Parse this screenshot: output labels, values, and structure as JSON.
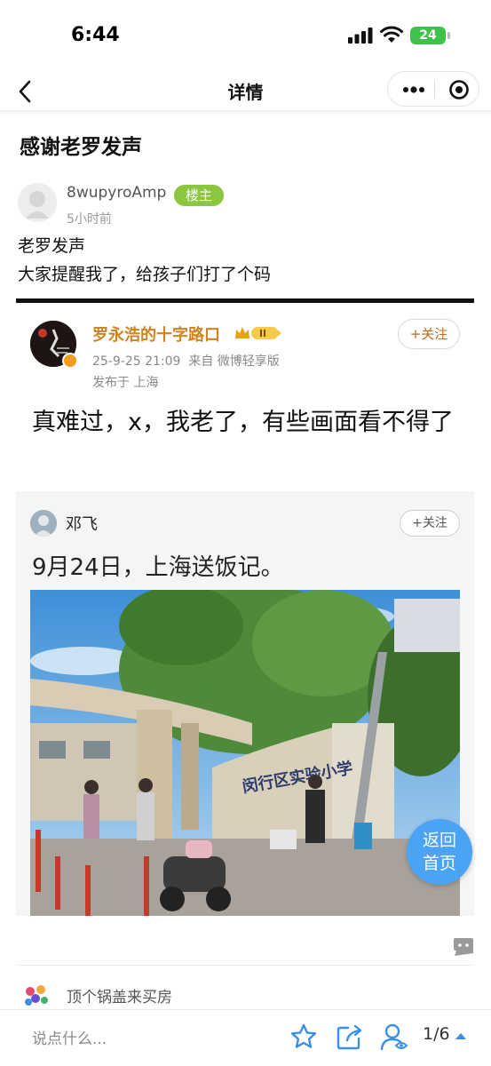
{
  "status": {
    "time": "6:44",
    "battery": "24"
  },
  "nav": {
    "title": "详情"
  },
  "post": {
    "title": "感谢老罗发声",
    "author": "8wupyroAmp",
    "op_badge": "楼主",
    "time": "5小时前",
    "body": [
      "老罗发声",
      "大家提醒我了，给孩子们打了个码"
    ]
  },
  "screenshot": {
    "weibo": {
      "name": "罗永浩的十字路口",
      "meta_time": "25-9-25 21:09",
      "meta_source": "来自 微博轻享版",
      "meta_location": "发布于 上海",
      "follow": "+关注",
      "text": "真难过，x，我老了，有些画面看不得了"
    },
    "quoted": {
      "name": "邓飞",
      "follow": "+关注",
      "text": "9月24日，上海送饭记。",
      "sign": "闵行区实验小学"
    }
  },
  "return_home": {
    "line1": "返回",
    "line2": "首页"
  },
  "reply": {
    "name": "顶个锅盖来买房"
  },
  "bottom": {
    "input_placeholder": "说点什么...",
    "page": "1/6"
  },
  "colors": {
    "op_badge": "#8bc63f",
    "weibo_name": "#d0821c",
    "return_home": "#4aa3f5",
    "bottom_icons": "#3b8fe6",
    "battery": "#3fc24b"
  },
  "icons": [
    "signal-icon",
    "wifi-icon",
    "back-arrow-icon",
    "more-icon",
    "close-circle-icon",
    "comment-icon",
    "star-icon",
    "share-icon",
    "user-icon",
    "chevron-up-icon"
  ]
}
